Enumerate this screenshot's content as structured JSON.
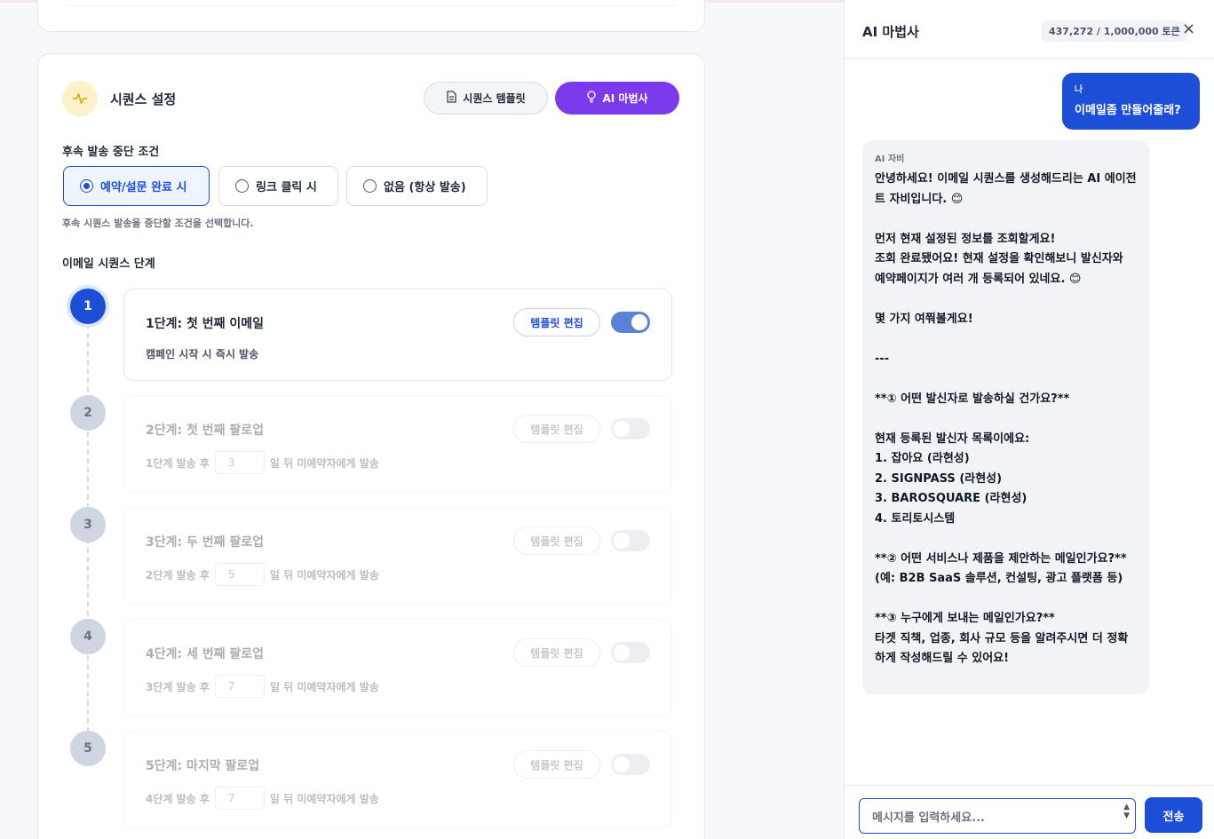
{
  "sequence": {
    "title": "시퀀스 설정",
    "template_button": "시퀀스 템플릿",
    "ai_button": "AI 마법사",
    "stop_condition": {
      "label": "후속 발송 중단 조건",
      "options": [
        "예약/설문 완료 시",
        "링크 클릭 시",
        "없음 (항상 발송)"
      ],
      "selected": "예약/설문 완료 시",
      "hint": "후속 시퀀스 발송을 중단할 조건을 선택합니다."
    },
    "steps_label": "이메일 시퀀스 단계",
    "steps": [
      {
        "num": "1",
        "title": "1단계: 첫 번째 이메일",
        "sub": "캠페인 시작 시 즉시 발송",
        "enabled": true
      },
      {
        "num": "2",
        "title": "2단계: 첫 번째 팔로업",
        "prefix": "1단계 발송 후",
        "days": "3",
        "suffix": "일 뒤 미예약자에게 발송",
        "enabled": false
      },
      {
        "num": "3",
        "title": "3단계: 두 번째 팔로업",
        "prefix": "2단계 발송 후",
        "days": "5",
        "suffix": "일 뒤 미예약자에게 발송",
        "enabled": false
      },
      {
        "num": "4",
        "title": "4단계: 세 번째 팔로업",
        "prefix": "3단계 발송 후",
        "days": "7",
        "suffix": "일 뒤 미예약자에게 발송",
        "enabled": false
      },
      {
        "num": "5",
        "title": "5단계: 마지막 팔로업",
        "prefix": "4단계 발송 후",
        "days": "7",
        "suffix": "일 뒤 미예약자에게 발송",
        "enabled": false
      }
    ],
    "edit_button": "템플릿 편집"
  },
  "panel": {
    "title": "AI 마법사",
    "tokens": "437,272 / 1,000,000 토큰",
    "close": "×",
    "user_message": {
      "who": "나",
      "text": "이메일좀 만들어줄래?"
    },
    "ai_message": {
      "who": "AI 자비",
      "text": "안녕하세요! 이메일 시퀀스를 생성해드리는 AI 에이전트 자비입니다. 😊\n\n먼저 현재 설정된 정보를 조회할게요!\n조회 완료됐어요! 현재 설정을 확인해보니 발신자와 예약페이지가 여러 개 등록되어 있네요. 😊\n\n몇 가지 여쭤볼게요!\n\n---\n\n**① 어떤 발신자로 발송하실 건가요?**\n\n현재 등록된 발신자 목록이에요:\n1. 잡아요 (라현성)\n2. SIGNPASS (라현성)\n3. BAROSQUARE (라현성)\n4. 토리토시스템\n\n**② 어떤 서비스나 제품을 제안하는 메일인가요?**\n(예: B2B SaaS 솔루션, 컨설팅, 광고 플랫폼 등)\n\n**③ 누구에게 보내는 메일인가요?**\n타겟 직책, 업종, 회사 규모 등을 알려주시면 더 정확하게 작성해드릴 수 있어요!"
    },
    "input_placeholder": "메시지를 입력하세요...",
    "send_button": "전송"
  },
  "colors": {
    "accent": "#1d4ed8",
    "ai_button": "#7c3aed"
  }
}
